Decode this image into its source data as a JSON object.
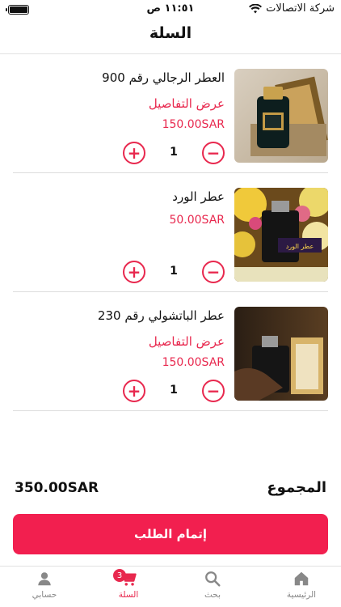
{
  "status_bar": {
    "carrier": "شركة الاتصالات",
    "time": "١١:٥١ ص"
  },
  "header": {
    "title": "السلة"
  },
  "cart": {
    "items": [
      {
        "name": "العطر الرجالي رقم 900",
        "details_link": "عرض التفاصيل",
        "price": "150.00SAR",
        "quantity": "1",
        "increase": "+",
        "decrease": "−"
      },
      {
        "name": "عطر الورد",
        "price": "50.00SAR",
        "quantity": "1",
        "increase": "+",
        "decrease": "−",
        "image_caption": "عطر الورد"
      },
      {
        "name": "عطر الباتشولي رقم 230",
        "details_link": "عرض التفاصيل",
        "price": "150.00SAR",
        "quantity": "1",
        "increase": "+",
        "decrease": "−"
      }
    ]
  },
  "summary": {
    "total_label": "المجموع",
    "total_value": "350.00SAR"
  },
  "checkout": {
    "label": "إتمام الطلب"
  },
  "tab_bar": {
    "items": [
      {
        "label": "الرئيسية",
        "icon": "home-icon"
      },
      {
        "label": "بحث",
        "icon": "search-icon"
      },
      {
        "label": "السلة",
        "icon": "cart-icon",
        "badge": "3",
        "active": true
      },
      {
        "label": "حسابي",
        "icon": "person-icon"
      }
    ]
  },
  "colors": {
    "accent": "#f21f4f",
    "text": "#111111",
    "tab_inactive": "#888888"
  }
}
